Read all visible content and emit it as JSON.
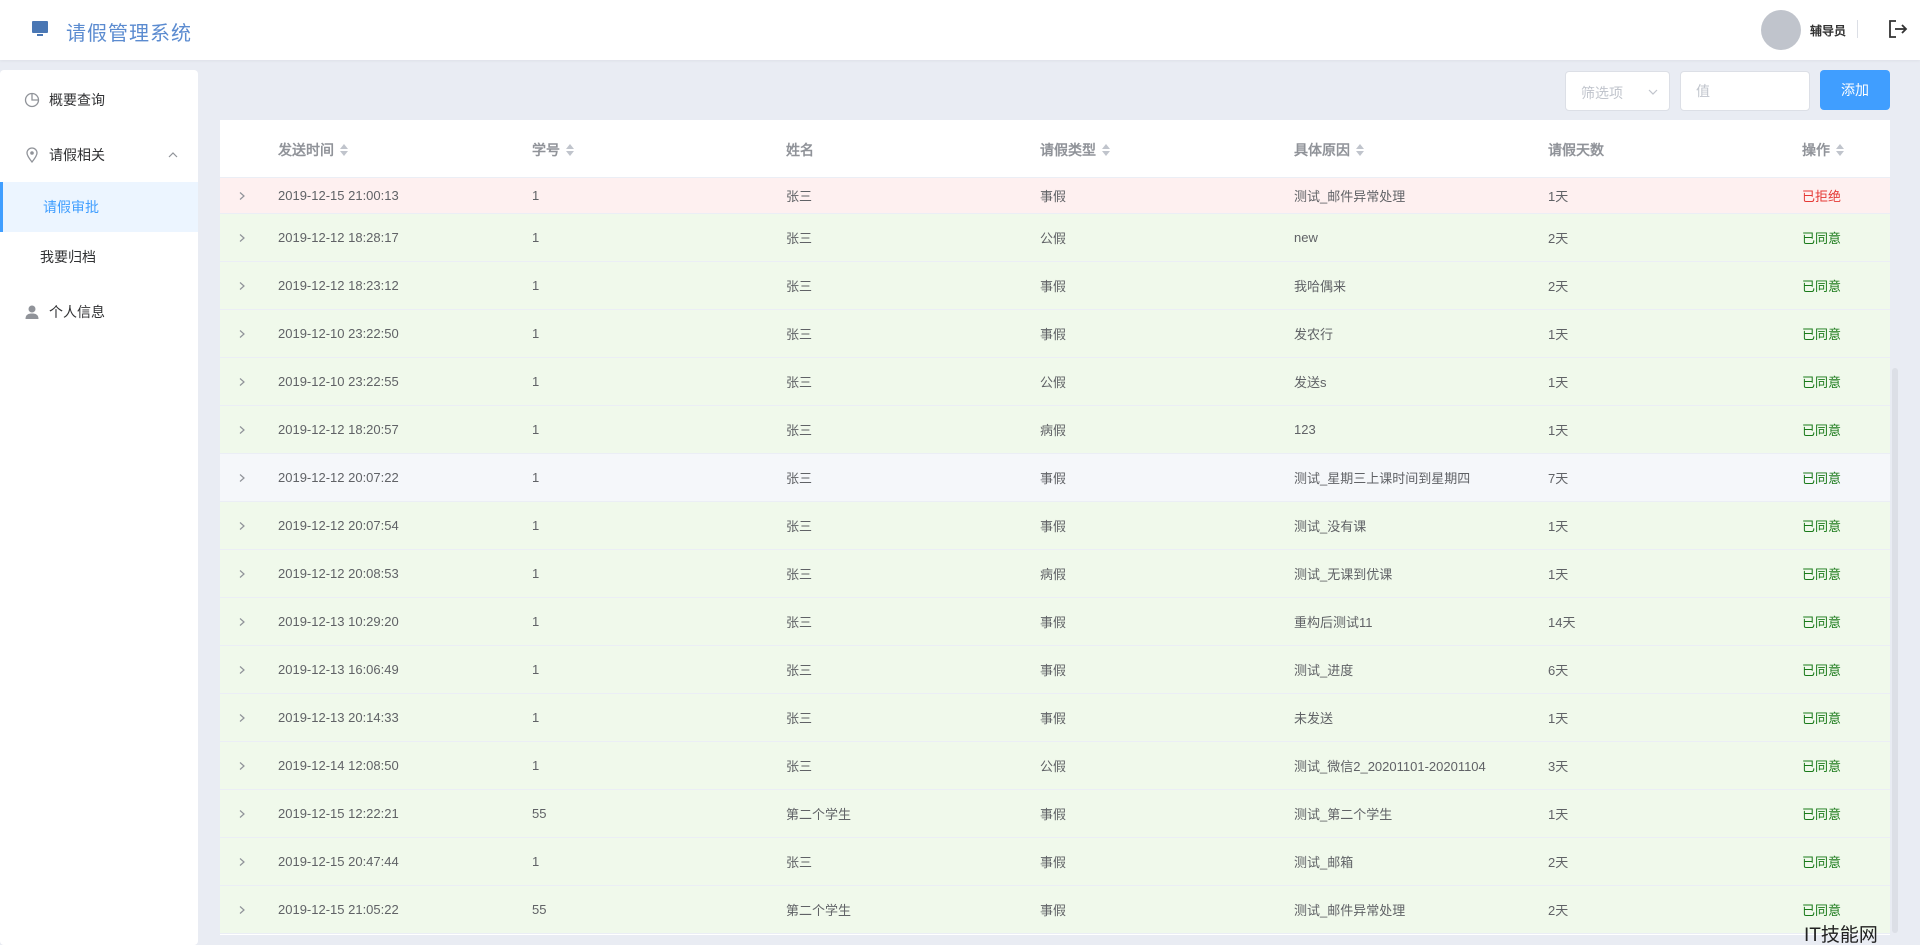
{
  "header": {
    "app_title": "请假管理系统",
    "user_name": "辅导员"
  },
  "sidebar": {
    "items": [
      {
        "label": "概要查询",
        "icon": "clock-icon"
      },
      {
        "label": "请假相关",
        "icon": "location-icon"
      },
      {
        "label": "个人信息",
        "icon": "user-icon"
      }
    ],
    "submenu": [
      {
        "label": "请假审批",
        "active": true
      },
      {
        "label": "我要归档",
        "active": false
      }
    ]
  },
  "toolbar": {
    "filter_placeholder": "筛选项",
    "value_placeholder": "值",
    "add_label": "添加"
  },
  "table": {
    "columns": [
      "发送时间",
      "学号",
      "姓名",
      "请假类型",
      "具体原因",
      "请假天数",
      "操作"
    ],
    "rows": [
      {
        "time": "2019-12-15 21:00:13",
        "sid": "1",
        "name": "张三",
        "type": "事假",
        "reason": "测试_邮件异常处理",
        "days": "1天",
        "status": "已拒绝",
        "state": "rejected"
      },
      {
        "time": "2019-12-12 18:28:17",
        "sid": "1",
        "name": "张三",
        "type": "公假",
        "reason": "new",
        "days": "2天",
        "status": "已同意",
        "state": "approved"
      },
      {
        "time": "2019-12-12 18:23:12",
        "sid": "1",
        "name": "张三",
        "type": "事假",
        "reason": "我哈偶来",
        "days": "2天",
        "status": "已同意",
        "state": "approved"
      },
      {
        "time": "2019-12-10 23:22:50",
        "sid": "1",
        "name": "张三",
        "type": "事假",
        "reason": "发农行",
        "days": "1天",
        "status": "已同意",
        "state": "approved"
      },
      {
        "time": "2019-12-10 23:22:55",
        "sid": "1",
        "name": "张三",
        "type": "公假",
        "reason": "发送s",
        "days": "1天",
        "status": "已同意",
        "state": "approved"
      },
      {
        "time": "2019-12-12 18:20:57",
        "sid": "1",
        "name": "张三",
        "type": "病假",
        "reason": "123",
        "days": "1天",
        "status": "已同意",
        "state": "approved"
      },
      {
        "time": "2019-12-12 20:07:22",
        "sid": "1",
        "name": "张三",
        "type": "事假",
        "reason": "测试_星期三上课时间到星期四",
        "days": "7天",
        "status": "已同意",
        "state": "hover"
      },
      {
        "time": "2019-12-12 20:07:54",
        "sid": "1",
        "name": "张三",
        "type": "事假",
        "reason": "测试_没有课",
        "days": "1天",
        "status": "已同意",
        "state": "approved"
      },
      {
        "time": "2019-12-12 20:08:53",
        "sid": "1",
        "name": "张三",
        "type": "病假",
        "reason": "测试_无课到优课",
        "days": "1天",
        "status": "已同意",
        "state": "approved"
      },
      {
        "time": "2019-12-13 10:29:20",
        "sid": "1",
        "name": "张三",
        "type": "事假",
        "reason": "重构后测试11",
        "days": "14天",
        "status": "已同意",
        "state": "approved"
      },
      {
        "time": "2019-12-13 16:06:49",
        "sid": "1",
        "name": "张三",
        "type": "事假",
        "reason": "测试_进度",
        "days": "6天",
        "status": "已同意",
        "state": "approved"
      },
      {
        "time": "2019-12-13 20:14:33",
        "sid": "1",
        "name": "张三",
        "type": "事假",
        "reason": "未发送",
        "days": "1天",
        "status": "已同意",
        "state": "approved"
      },
      {
        "time": "2019-12-14 12:08:50",
        "sid": "1",
        "name": "张三",
        "type": "公假",
        "reason": "测试_微信2_20201101-20201104",
        "days": "3天",
        "status": "已同意",
        "state": "approved"
      },
      {
        "time": "2019-12-15 12:22:21",
        "sid": "55",
        "name": "第二个学生",
        "type": "事假",
        "reason": "测试_第二个学生",
        "days": "1天",
        "status": "已同意",
        "state": "approved"
      },
      {
        "time": "2019-12-15 20:47:44",
        "sid": "1",
        "name": "张三",
        "type": "事假",
        "reason": "测试_邮箱",
        "days": "2天",
        "status": "已同意",
        "state": "approved"
      },
      {
        "time": "2019-12-15 21:05:22",
        "sid": "55",
        "name": "第二个学生",
        "type": "事假",
        "reason": "测试_邮件异常处理",
        "days": "2天",
        "status": "已同意",
        "state": "approved"
      }
    ]
  },
  "watermark": "IT技能网",
  "colors": {
    "accent": "#409eff",
    "approved_text": "#1a7a1a",
    "rejected_text": "#e53935",
    "approved_row": "#f0f9eb",
    "rejected_row": "#fef0f0"
  }
}
